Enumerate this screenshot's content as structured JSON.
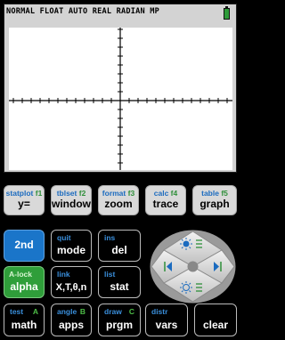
{
  "screen": {
    "status_text": "NORMAL FLOAT AUTO REAL RADIAN MP",
    "battery_color": "#2e9b3a"
  },
  "function_keys": [
    {
      "secondary": "statplot",
      "fn": "f1",
      "label": "y="
    },
    {
      "secondary": "tblset",
      "fn": "f2",
      "label": "window"
    },
    {
      "secondary": "format",
      "fn": "f3",
      "label": "zoom"
    },
    {
      "secondary": "calc",
      "fn": "f4",
      "label": "trace"
    },
    {
      "secondary": "table",
      "fn": "f5",
      "label": "graph"
    }
  ],
  "keys": {
    "second": {
      "label": "2nd"
    },
    "mode": {
      "secondary": "quit",
      "label": "mode"
    },
    "del": {
      "secondary": "ins",
      "label": "del"
    },
    "alpha": {
      "secondary": "A-lock",
      "label": "alpha"
    },
    "xt": {
      "secondary": "link",
      "label": "X,T,θ,n"
    },
    "stat": {
      "secondary": "list",
      "label": "stat"
    },
    "math": {
      "secondary": "test",
      "alpha_char": "A",
      "label": "math"
    },
    "apps": {
      "secondary": "angle",
      "alpha_char": "B",
      "label": "apps"
    },
    "prgm": {
      "secondary": "draw",
      "alpha_char": "C",
      "label": "prgm"
    },
    "vars": {
      "secondary": "distr",
      "label": "vars"
    },
    "clear": {
      "label": "clear"
    }
  },
  "colors": {
    "second_key": "#1a75c9",
    "alpha_key": "#2f9e3a",
    "secondary_text": "#3a8fdc",
    "alpha_text": "#4fbf48",
    "function_text": "#2f8f3a"
  }
}
